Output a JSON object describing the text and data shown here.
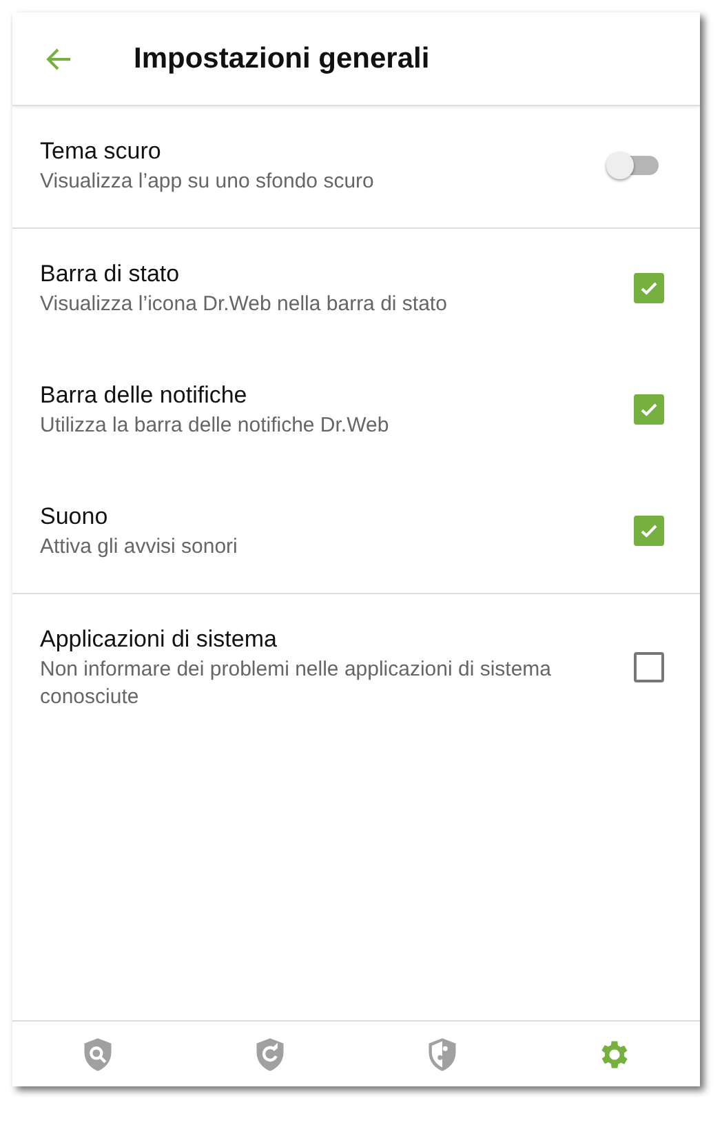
{
  "header": {
    "title": "Impostazioni generali"
  },
  "sections": [
    {
      "items": [
        {
          "kind": "switch",
          "title": "Tema scuro",
          "subtitle": "Visualizza l’app su uno sfondo scuro",
          "on": false
        }
      ]
    },
    {
      "items": [
        {
          "kind": "checkbox",
          "title": "Barra di stato",
          "subtitle": "Visualizza l’icona Dr.Web nella barra di stato",
          "checked": true
        },
        {
          "kind": "checkbox",
          "title": "Barra delle notifiche",
          "subtitle": "Utilizza la barra delle notifiche Dr.Web",
          "checked": true
        },
        {
          "kind": "checkbox",
          "title": "Suono",
          "subtitle": "Attiva gli avvisi sonori",
          "checked": true
        }
      ]
    },
    {
      "items": [
        {
          "kind": "checkbox",
          "title": "Applicazioni di sistema",
          "subtitle": "Non informare dei problemi nelle applicazioni di sistema conosciute",
          "checked": false
        }
      ]
    }
  ],
  "nav": [
    {
      "selected": false
    },
    {
      "selected": false
    },
    {
      "selected": false
    },
    {
      "selected": true
    }
  ]
}
